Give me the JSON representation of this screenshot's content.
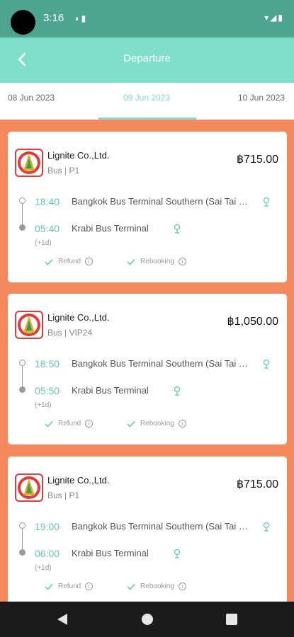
{
  "status_bar": {
    "time": "3:16",
    "left_icons": "◑ ▮",
    "right_icons": "▾◢▮"
  },
  "header": {
    "title": "Departure"
  },
  "date_tabs": [
    {
      "label": "08 Jun 2023",
      "active": false
    },
    {
      "label": "09 Jun 2023",
      "active": true
    },
    {
      "label": "10 Jun 2023",
      "active": false
    }
  ],
  "trips": [
    {
      "operator": "Lignite Co.,Ltd.",
      "vehicle": "Bus | P1",
      "price": "฿715.00",
      "departure_time": "18:40",
      "departure_station": "Bangkok Bus Terminal Southern (Sai Tai Mai)",
      "arrival_time": "05:40",
      "arrival_station": "Krabi Bus Terminal",
      "day_offset": "(+1d)",
      "refund_label": "Refund",
      "rebooking_label": "Rebooking"
    },
    {
      "operator": "Lignite Co.,Ltd.",
      "vehicle": "Bus | VIP24",
      "price": "฿1,050.00",
      "departure_time": "18:50",
      "departure_station": "Bangkok Bus Terminal Southern (Sai Tai Mai)",
      "arrival_time": "05:50",
      "arrival_station": "Krabi Bus Terminal",
      "day_offset": "(+1d)",
      "refund_label": "Refund",
      "rebooking_label": "Rebooking"
    },
    {
      "operator": "Lignite Co.,Ltd.",
      "vehicle": "Bus | P1",
      "price": "฿715.00",
      "departure_time": "19:00",
      "departure_station": "Bangkok Bus Terminal Southern (Sai Tai Mai)",
      "arrival_time": "06:00",
      "arrival_station": "Krabi Bus Terminal",
      "day_offset": "(+1d)",
      "refund_label": "Refund",
      "rebooking_label": "Rebooking"
    }
  ],
  "icons": {
    "back": "back-arrow-icon",
    "pin": "location-pin-icon",
    "check": "check-icon",
    "info": "info-icon"
  },
  "colors": {
    "accent": "#80dfca",
    "status_bar": "#4ea58f",
    "background": "#f4895e",
    "time_text": "#63c9b3"
  }
}
